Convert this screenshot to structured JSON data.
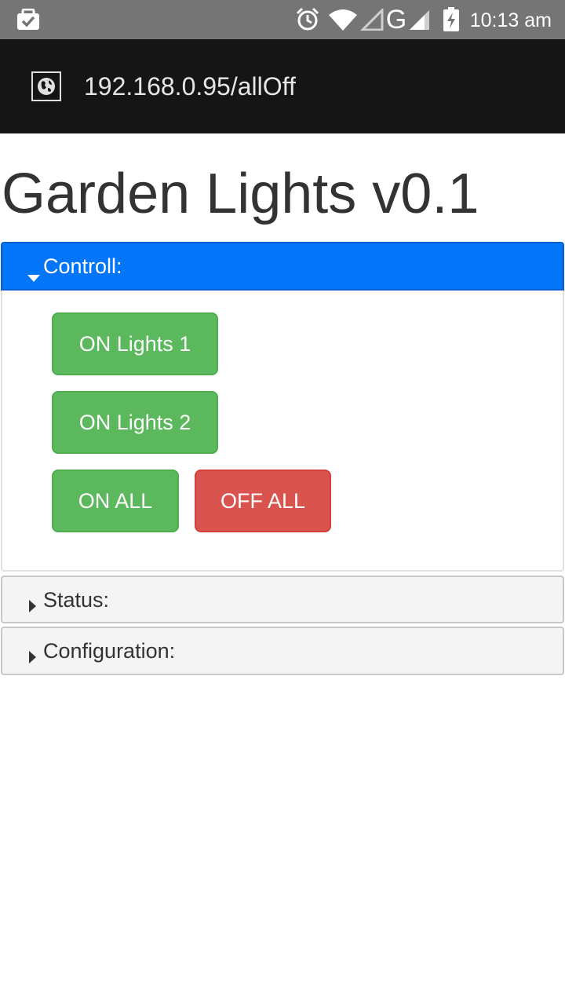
{
  "status_bar": {
    "time": "10:13 am",
    "network_type": "G",
    "icons": [
      "briefcase-check-icon",
      "alarm-icon",
      "wifi-icon",
      "signal-empty-icon",
      "signal-icon",
      "battery-charging-icon"
    ]
  },
  "browser": {
    "url": "192.168.0.95/allOff",
    "site_icon": "globe-icon"
  },
  "page": {
    "title": "Garden Lights v0.1"
  },
  "panels": {
    "control": {
      "label": "Controll:",
      "expanded": true,
      "buttons": {
        "on_lights_1": "ON Lights 1",
        "on_lights_2": "ON Lights 2",
        "on_all": "ON ALL",
        "off_all": "OFF ALL"
      }
    },
    "status": {
      "label": "Status:",
      "expanded": false
    },
    "configuration": {
      "label": "Configuration:",
      "expanded": false
    }
  },
  "colors": {
    "primary": "#0275f8",
    "success": "#5cb85c",
    "danger": "#d9534f",
    "status_bar": "#757575",
    "url_bar": "#151515"
  }
}
